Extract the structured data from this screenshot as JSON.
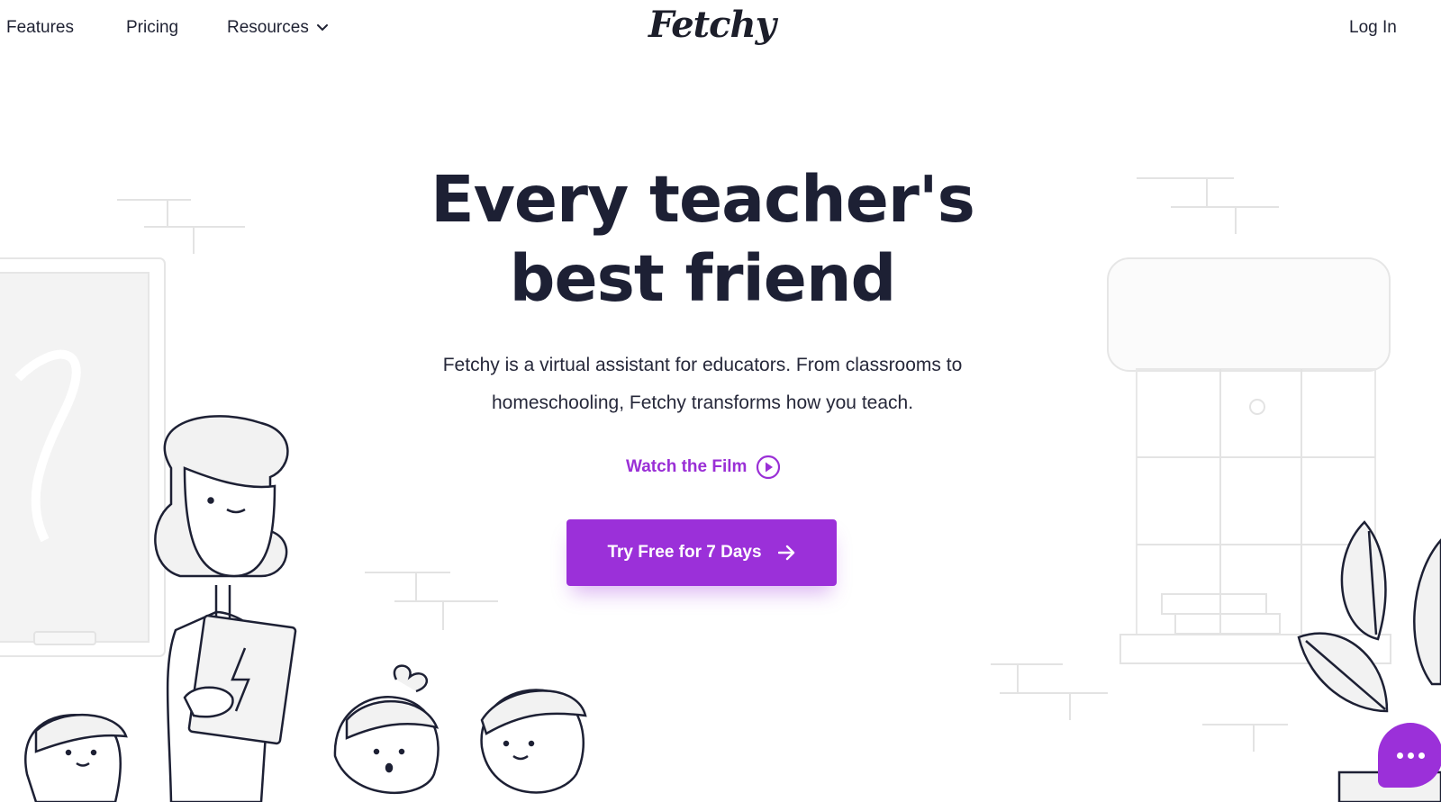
{
  "nav": {
    "features": "Features",
    "pricing": "Pricing",
    "resources": "Resources",
    "login": "Log In"
  },
  "logo": "Fetchy",
  "hero": {
    "title_line1": "Every teacher's",
    "title_line2": "best friend",
    "subtitle_line1": "Fetchy is a virtual assistant for educators. From classrooms to",
    "subtitle_line2": "homeschooling, Fetchy transforms how you teach.",
    "watch_label": "Watch the Film",
    "cta_label": "Try Free for 7 Days"
  },
  "colors": {
    "brand": "#9b30d9",
    "text_dark": "#1d2034",
    "line_gray": "#d9d9d9"
  },
  "icons": {
    "resources_chevron": "chevron-down-icon",
    "watch": "play-circle-icon",
    "cta": "arrow-right-icon",
    "chat": "chat-bubble-icon"
  }
}
